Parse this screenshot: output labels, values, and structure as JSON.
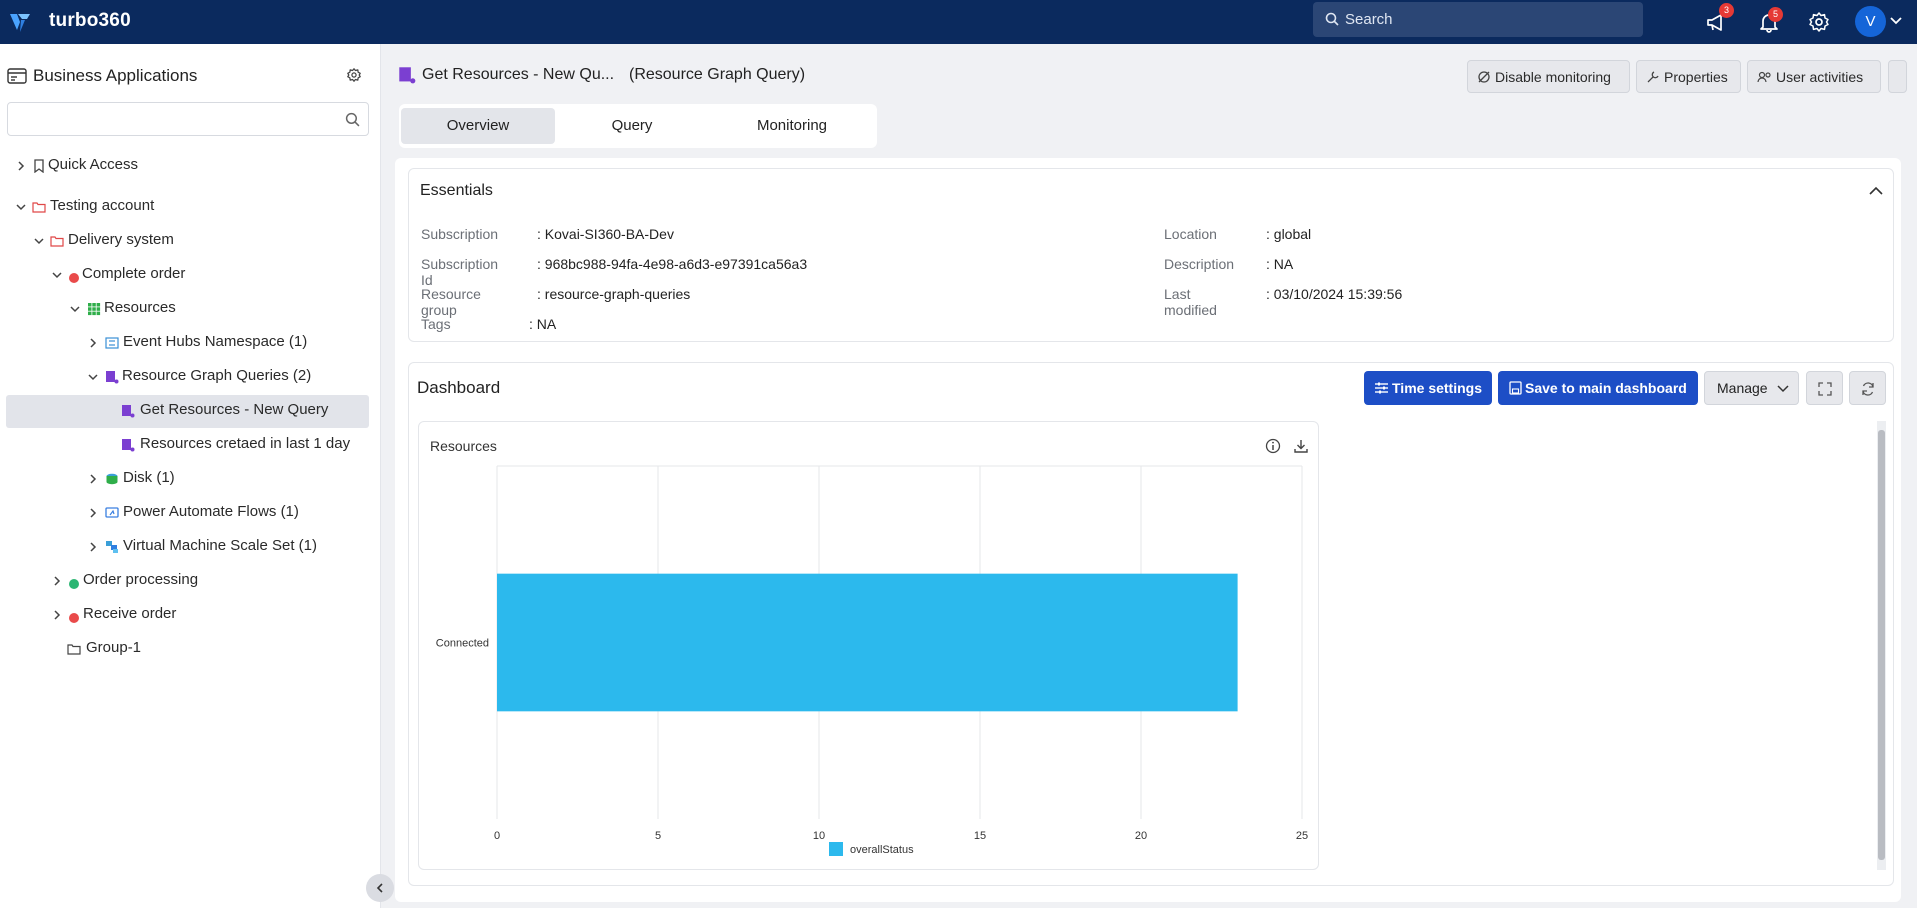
{
  "app": {
    "brand": "turbo360",
    "search_placeholder": "Search",
    "announcements_badge": "3",
    "notifications_badge": "5",
    "avatar_initial": "V"
  },
  "sidebar": {
    "title": "Business Applications",
    "search_value": "",
    "tree": {
      "quick_access": "Quick Access",
      "testing_account": "Testing account",
      "delivery_system": "Delivery system",
      "complete_order": "Complete order",
      "resources": "Resources",
      "event_hubs": "Event Hubs Namespace (1)",
      "rg_queries": "Resource Graph Queries (2)",
      "get_resources": "Get Resources - New Query",
      "resources_created": "Resources cretaed in last 1 day",
      "disk": "Disk (1)",
      "power_automate": "Power Automate Flows (1)",
      "vmss": "Virtual Machine Scale Set (1)",
      "order_processing": "Order processing",
      "receive_order": "Receive order",
      "group1": "Group-1"
    }
  },
  "header": {
    "title": "Get Resources - New Qu...",
    "subtitle": "(Resource Graph Query)",
    "disable_monitoring": "Disable monitoring",
    "properties": "Properties",
    "user_activities": "User activities"
  },
  "tabs": [
    "Overview",
    "Query",
    "Monitoring"
  ],
  "essentials": {
    "title": "Essentials",
    "subscription_k": "Subscription",
    "subscription_v": ": Kovai-SI360-BA-Dev",
    "subscription_id_k": "Subscription Id",
    "subscription_id_v": ": 968bc988-94fa-4e98-a6d3-e97391ca56a3",
    "resource_group_k": "Resource group",
    "resource_group_v": ": resource-graph-queries",
    "tags_k": "Tags",
    "tags_v": ": NA",
    "location_k": "Location",
    "location_v": ": global",
    "description_k": "Description",
    "description_v": ": NA",
    "last_modified_k": "Last modified",
    "last_modified_v": ": 03/10/2024 15:39:56"
  },
  "dashboard": {
    "title": "Dashboard",
    "time_settings": "Time settings",
    "save_main": "Save to main dashboard",
    "manage": "Manage"
  },
  "chart_data": {
    "type": "bar",
    "orientation": "horizontal",
    "title": "Resources",
    "categories": [
      "Connected"
    ],
    "series": [
      {
        "name": "overallStatus",
        "values": [
          23
        ],
        "color": "#2cb9ed"
      }
    ],
    "xlim": [
      0,
      25
    ],
    "xticks": [
      0,
      5,
      10,
      15,
      20,
      25
    ],
    "grid": true,
    "legend": "bottom"
  }
}
